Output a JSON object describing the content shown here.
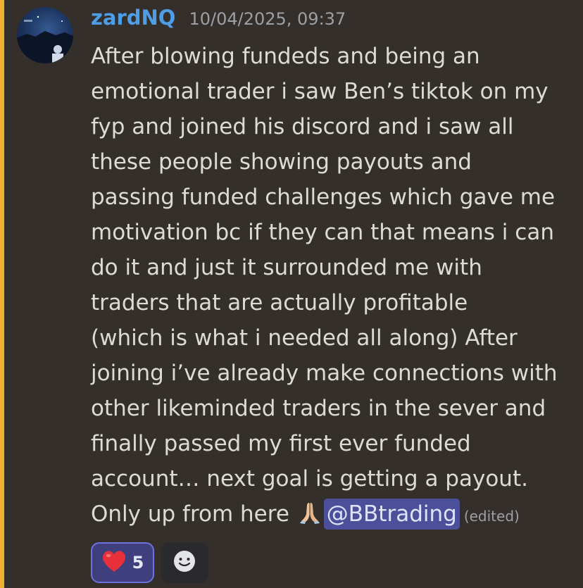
{
  "message": {
    "author": "zardNQ",
    "timestamp": "10/04/2025, 09:37",
    "lines": [
      "After blowing fundeds and being an",
      "emotional trader i saw Ben’s tiktok on my",
      "fyp and joined his discord and i saw all",
      "these people showing payouts and",
      "passing funded challenges which gave me",
      "motivation bc if they can that means i can",
      "do it and just it surrounded me with",
      "traders that are actually profitable",
      "(which is what i needed all along) After",
      "joining i’ve already make connections with",
      "other likeminded traders in the sever and",
      "finally passed my first ever funded",
      "account… next goal is getting a payout."
    ],
    "last_line_text": "Only up from here",
    "last_line_emoji": "folded-hands-emoji",
    "mention": "@BBtrading",
    "edited_label": "(edited)"
  },
  "reactions": [
    {
      "emoji": "red-heart-emoji",
      "count": "5",
      "selected": true
    }
  ],
  "add_reaction_icon": "add-reaction-smiley-icon",
  "colors": {
    "background": "#342f2a",
    "accent_bar": "#f0b132",
    "username": "#4e9de7",
    "mention_bg": "#4c4f9a",
    "reaction_border": "#6e72e0"
  }
}
